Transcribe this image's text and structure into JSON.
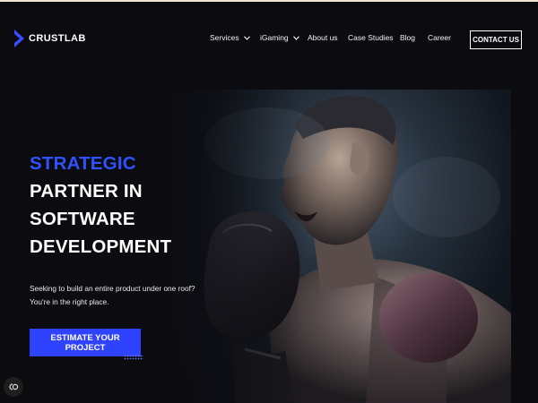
{
  "brand": {
    "name": "CRUSTLAB",
    "logo_color": "#3a4cff"
  },
  "nav": {
    "items": [
      {
        "label": "Services",
        "has_dropdown": true
      },
      {
        "label": "iGaming",
        "has_dropdown": true
      },
      {
        "label": "About us",
        "has_dropdown": false
      },
      {
        "label": "Case Studies",
        "has_dropdown": false
      },
      {
        "label": "Blog",
        "has_dropdown": false
      },
      {
        "label": "Career",
        "has_dropdown": false
      }
    ],
    "contact_label": "CONTACT US"
  },
  "hero": {
    "headline_accent": "STRATEGIC",
    "headline_lines": [
      "PARTNER IN",
      "SOFTWARE",
      "DEVELOPMENT"
    ],
    "subtext_lines": [
      "Seeking to build an entire product under one roof?",
      "You're in the right place."
    ],
    "cta_label": "ESTIMATE YOUR PROJECT",
    "image_icon": "boxer-photo",
    "accent_color": "#2f52ff",
    "button_color": "#2f43ff"
  },
  "widget": {
    "icon": "cookie-settings-icon"
  }
}
